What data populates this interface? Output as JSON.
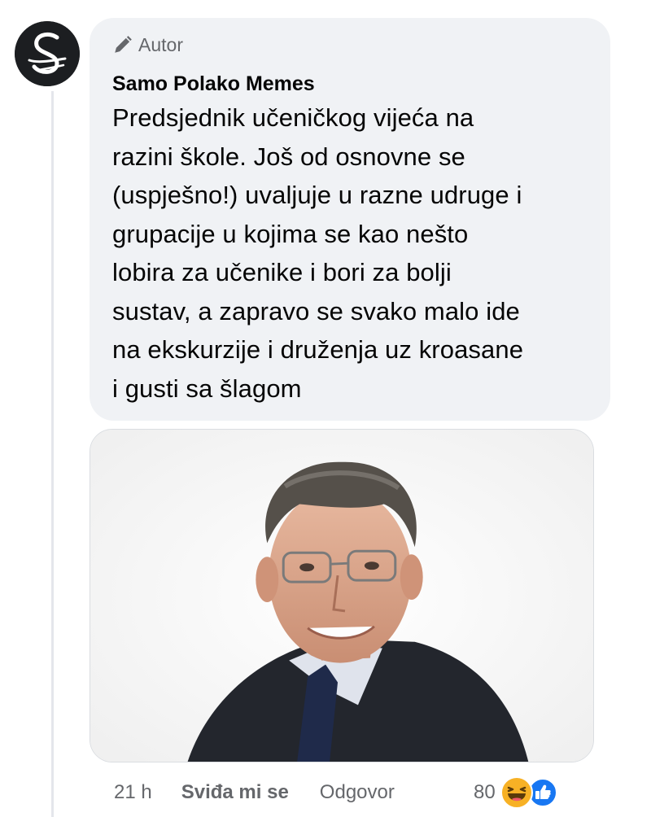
{
  "comment": {
    "author_badge": "Autor",
    "author_name": "Samo Polako Memes",
    "text": "Predsjednik učeničkog vijeća na\nrazini škole. Još od osnovne se\n(uspješno!) uvaljuje u razne udruge i\ngrupacije u kojima se kao nešto\nlobira za učenike i bori za bolji\nsustav, a zapravo se svako malo ide\nna ekskurzije i druženja uz kroasane\ni gusti sa šlagom"
  },
  "actions": {
    "time": "21 h",
    "like_label": "Sviđa mi se",
    "reply_label": "Odgovor"
  },
  "reactions": {
    "count": "80",
    "icons": [
      "haha-icon",
      "like-icon"
    ]
  },
  "colors": {
    "bubble": "#f0f2f5",
    "meta_text": "#65676b",
    "like_blue": "#1877f2",
    "haha_yellow": "#f7b125"
  }
}
